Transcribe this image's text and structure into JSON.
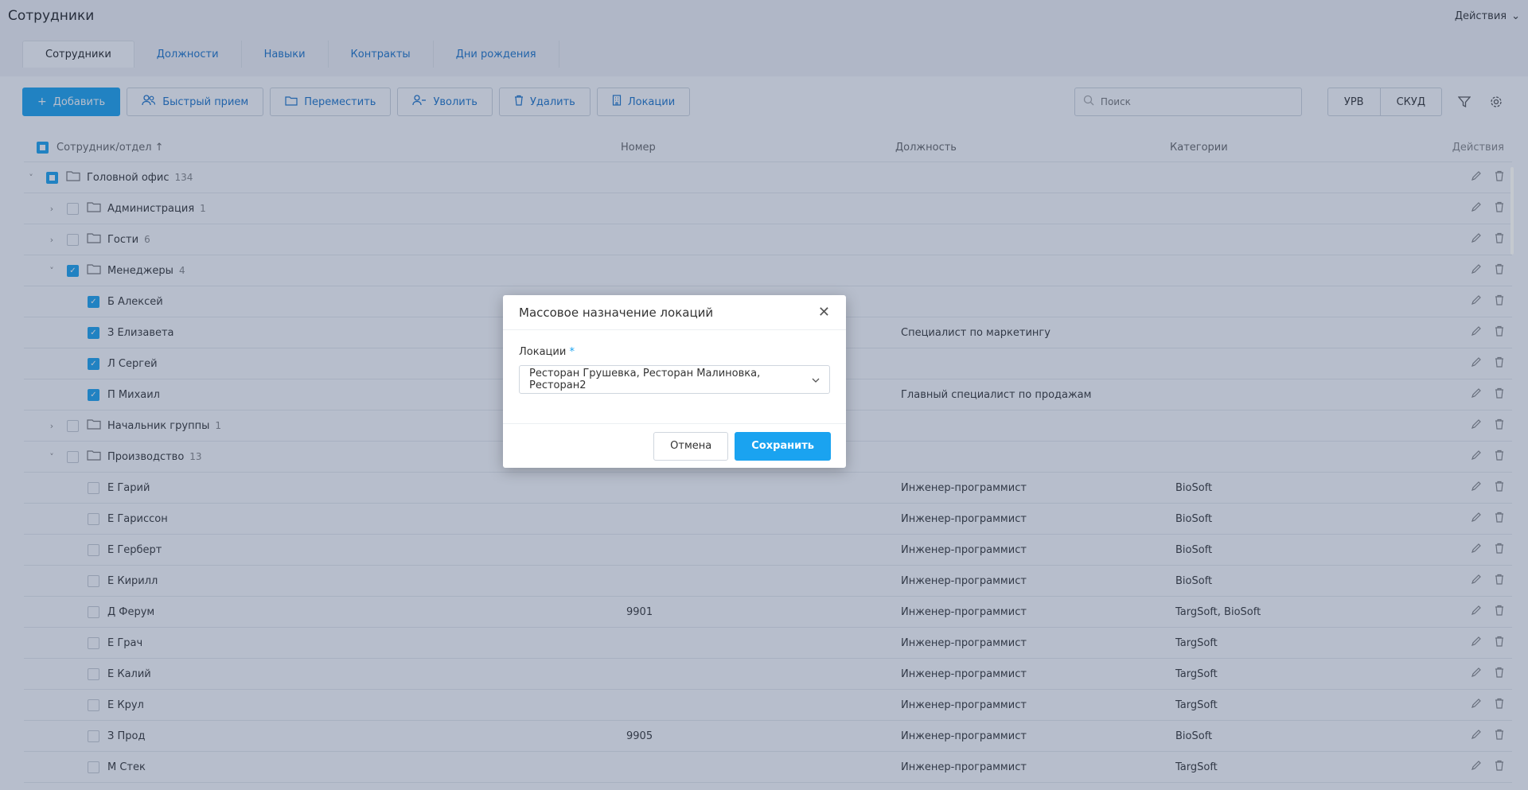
{
  "header": {
    "title": "Сотрудники",
    "actions_label": "Действия"
  },
  "tabs": [
    {
      "label": "Сотрудники"
    },
    {
      "label": "Должности"
    },
    {
      "label": "Навыки"
    },
    {
      "label": "Контракты"
    },
    {
      "label": "Дни рождения"
    }
  ],
  "toolbar": {
    "add": "Добавить",
    "quick_hire": "Быстрый прием",
    "move": "Переместить",
    "dismiss": "Уволить",
    "delete": "Удалить",
    "locations": "Локации",
    "search_placeholder": "Поиск",
    "urv": "УРВ",
    "skud": "СКУД"
  },
  "table": {
    "columns": {
      "name": "Сотрудник/отдел ↑",
      "number": "Номер",
      "position": "Должность",
      "categories": "Категории",
      "actions": "Действия"
    },
    "rows": [
      {
        "name": "Головной офис",
        "count": "134",
        "number": "",
        "position": "",
        "categories": ""
      },
      {
        "name": "Администрация",
        "count": "1",
        "number": "",
        "position": "",
        "categories": ""
      },
      {
        "name": "Гости",
        "count": "6",
        "number": "",
        "position": "",
        "categories": ""
      },
      {
        "name": "Менеджеры",
        "count": "4",
        "number": "",
        "position": "",
        "categories": ""
      },
      {
        "name": "Б Алексей",
        "count": "",
        "number": "",
        "position": "",
        "categories": ""
      },
      {
        "name": "З Елизавета",
        "count": "",
        "number": "",
        "position": "Специалист по маркетингу",
        "categories": ""
      },
      {
        "name": "Л Сергей",
        "count": "",
        "number": "",
        "position": "",
        "categories": ""
      },
      {
        "name": "П Михаил",
        "count": "",
        "number": "",
        "position": "Главный специалист по продажам",
        "categories": ""
      },
      {
        "name": "Начальник группы",
        "count": "1",
        "number": "",
        "position": "",
        "categories": ""
      },
      {
        "name": "Производство",
        "count": "13",
        "number": "",
        "position": "",
        "categories": ""
      },
      {
        "name": "Е Гарий",
        "count": "",
        "number": "",
        "position": "Инженер-программист",
        "categories": "BioSoft"
      },
      {
        "name": "Е Гариссон",
        "count": "",
        "number": "",
        "position": "Инженер-программист",
        "categories": "BioSoft"
      },
      {
        "name": "Е Герберт",
        "count": "",
        "number": "",
        "position": "Инженер-программист",
        "categories": "BioSoft"
      },
      {
        "name": "Е Кирилл",
        "count": "",
        "number": "",
        "position": "Инженер-программист",
        "categories": "BioSoft"
      },
      {
        "name": "Д Ферум",
        "count": "",
        "number": "9901",
        "position": "Инженер-программист",
        "categories": "TargSoft, BioSoft"
      },
      {
        "name": "Е Грач",
        "count": "",
        "number": "",
        "position": "Инженер-программист",
        "categories": "TargSoft"
      },
      {
        "name": "Е Калий",
        "count": "",
        "number": "",
        "position": "Инженер-программист",
        "categories": "TargSoft"
      },
      {
        "name": "Е Крул",
        "count": "",
        "number": "",
        "position": "Инженер-программист",
        "categories": "TargSoft"
      },
      {
        "name": "З Прод",
        "count": "",
        "number": "9905",
        "position": "Инженер-программист",
        "categories": "BioSoft"
      },
      {
        "name": "М Стек",
        "count": "",
        "number": "",
        "position": "Инженер-программист",
        "categories": "TargSoft"
      }
    ]
  },
  "modal": {
    "title": "Массовое назначение локаций",
    "field_label": "Локации",
    "required_mark": "*",
    "field_value": "Ресторан Грушевка, Ресторан Малиновка, Ресторан2",
    "cancel": "Отмена",
    "save": "Сохранить"
  },
  "colors": {
    "accent": "#1aa3f0",
    "link": "#1a73c9",
    "overlay": "rgba(50,70,110,0.35)"
  },
  "icons": [
    "plus-icon",
    "users-icon",
    "folder-icon",
    "user-minus-icon",
    "trash-icon",
    "building-icon",
    "search-icon",
    "filter-icon",
    "gear-icon",
    "pencil-icon",
    "chevron-down-icon",
    "chevron-right-icon",
    "close-icon"
  ]
}
